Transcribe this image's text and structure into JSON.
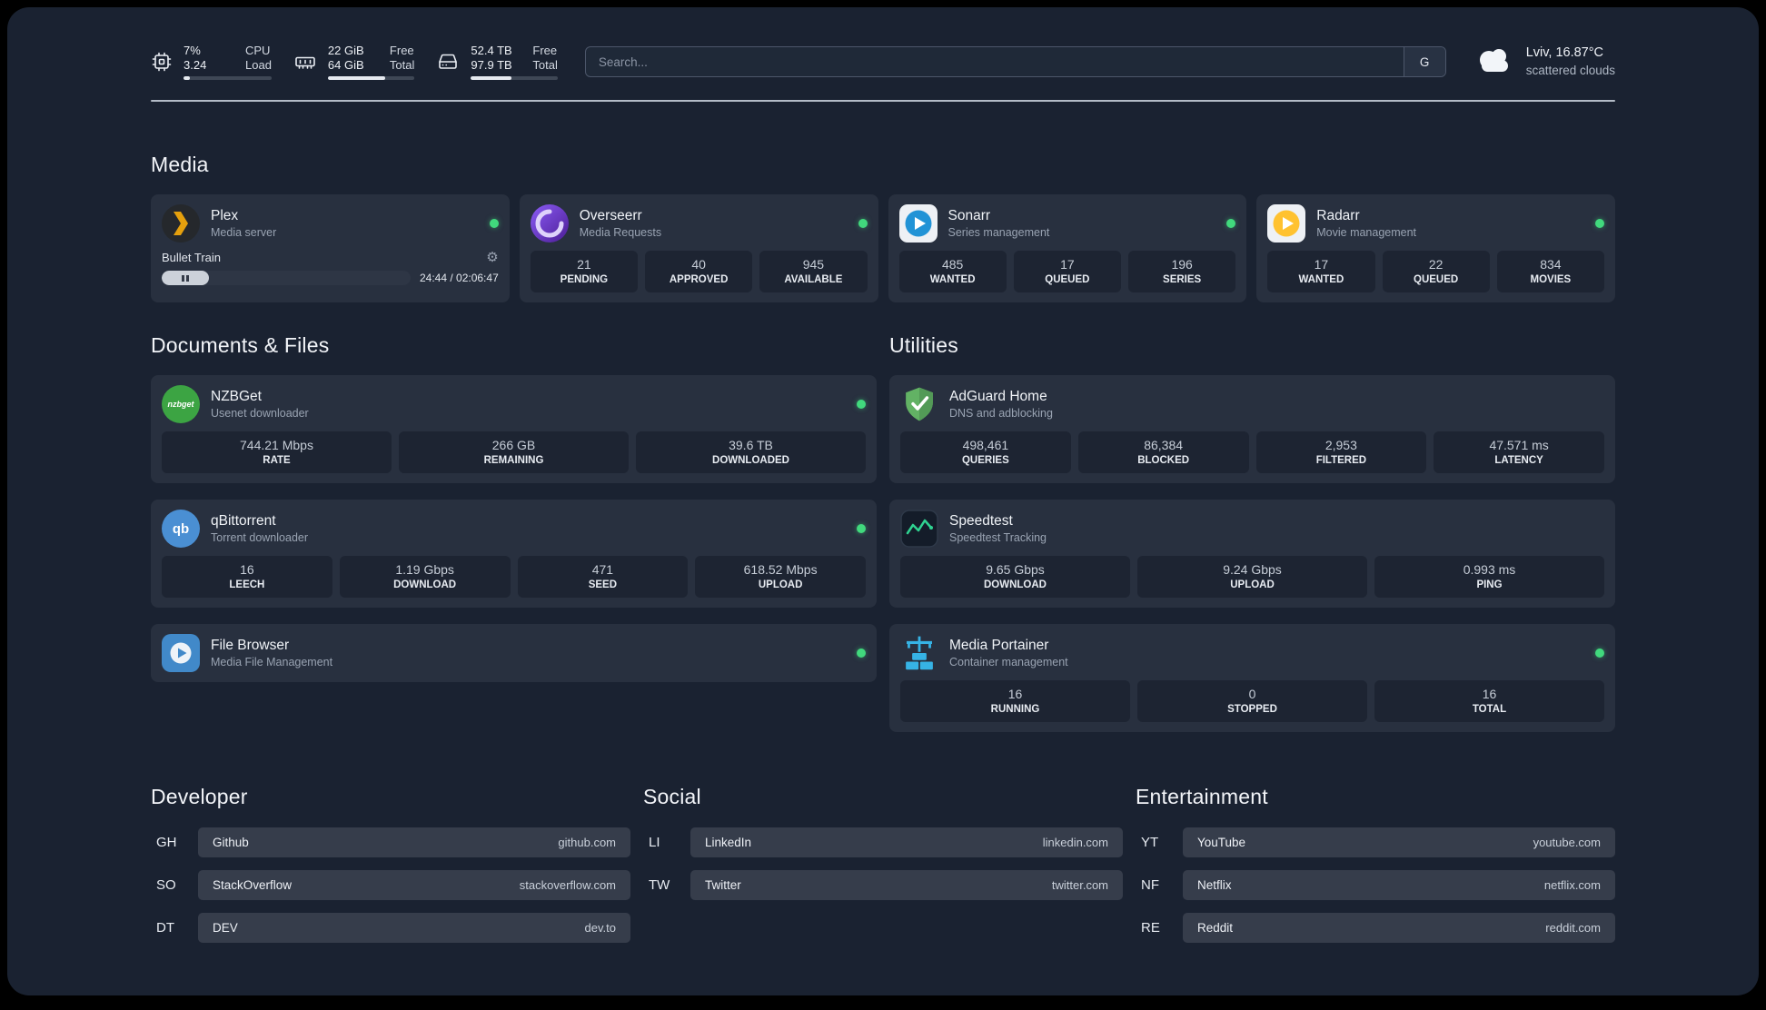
{
  "theme": {
    "page_bg": "#1a2231",
    "card_bg": "#28303f",
    "tile_bg": "#1d2432",
    "pill_bg": "#363d4b",
    "status_green": "#41d97d"
  },
  "icons": {
    "settings": "⚙"
  },
  "header": {
    "cpu": {
      "value_top": "7%",
      "value_bottom": "3.24",
      "label_top": "CPU",
      "label_bottom": "Load"
    },
    "memory": {
      "value_top": "22 GiB",
      "value_bottom": "64 GiB",
      "label_top": "Free",
      "label_bottom": "Total"
    },
    "disk": {
      "value_top": "52.4 TB",
      "value_bottom": "97.9 TB",
      "label_top": "Free",
      "label_bottom": "Total"
    },
    "search": {
      "placeholder": "Search...",
      "provider_label": "G"
    },
    "weather": {
      "location": "Lviv, 16.87°C",
      "condition": "scattered clouds"
    }
  },
  "meters": {
    "cpu_pct": 7,
    "memory_used_pct": 66,
    "disk_used_pct": 47,
    "plex_progress_pct": 19
  },
  "sections": {
    "media": "Media",
    "documents": "Documents & Files",
    "utilities": "Utilities"
  },
  "services": {
    "plex": {
      "name": "Plex",
      "subtitle": "Media server",
      "now_playing": "Bullet Train",
      "time": "24:44 / 02:06:47"
    },
    "overseerr": {
      "name": "Overseerr",
      "subtitle": "Media Requests",
      "stats": [
        {
          "value": "21",
          "label": "PENDING"
        },
        {
          "value": "40",
          "label": "APPROVED"
        },
        {
          "value": "945",
          "label": "AVAILABLE"
        }
      ]
    },
    "sonarr": {
      "name": "Sonarr",
      "subtitle": "Series management",
      "stats": [
        {
          "value": "485",
          "label": "WANTED"
        },
        {
          "value": "17",
          "label": "QUEUED"
        },
        {
          "value": "196",
          "label": "SERIES"
        }
      ]
    },
    "radarr": {
      "name": "Radarr",
      "subtitle": "Movie management",
      "stats": [
        {
          "value": "17",
          "label": "WANTED"
        },
        {
          "value": "22",
          "label": "QUEUED"
        },
        {
          "value": "834",
          "label": "MOVIES"
        }
      ]
    },
    "nzbget": {
      "name": "NZBGet",
      "subtitle": "Usenet downloader",
      "icon_text": "nzbget",
      "stats": [
        {
          "value": "744.21 Mbps",
          "label": "RATE"
        },
        {
          "value": "266 GB",
          "label": "REMAINING"
        },
        {
          "value": "39.6 TB",
          "label": "DOWNLOADED"
        }
      ]
    },
    "qbittorrent": {
      "name": "qBittorrent",
      "subtitle": "Torrent downloader",
      "icon_text": "qb",
      "stats": [
        {
          "value": "16",
          "label": "LEECH"
        },
        {
          "value": "1.19 Gbps",
          "label": "DOWNLOAD"
        },
        {
          "value": "471",
          "label": "SEED"
        },
        {
          "value": "618.52 Mbps",
          "label": "UPLOAD"
        }
      ]
    },
    "filebrowser": {
      "name": "File Browser",
      "subtitle": "Media File Management"
    },
    "adguard": {
      "name": "AdGuard Home",
      "subtitle": "DNS and adblocking",
      "stats": [
        {
          "value": "498,461",
          "label": "QUERIES"
        },
        {
          "value": "86,384",
          "label": "BLOCKED"
        },
        {
          "value": "2,953",
          "label": "FILTERED"
        },
        {
          "value": "47.571 ms",
          "label": "LATENCY"
        }
      ]
    },
    "speedtest": {
      "name": "Speedtest",
      "subtitle": "Speedtest Tracking",
      "stats": [
        {
          "value": "9.65 Gbps",
          "label": "DOWNLOAD"
        },
        {
          "value": "9.24 Gbps",
          "label": "UPLOAD"
        },
        {
          "value": "0.993 ms",
          "label": "PING"
        }
      ]
    },
    "portainer": {
      "name": "Media Portainer",
      "subtitle": "Container management",
      "stats": [
        {
          "value": "16",
          "label": "RUNNING"
        },
        {
          "value": "0",
          "label": "STOPPED"
        },
        {
          "value": "16",
          "label": "TOTAL"
        }
      ]
    }
  },
  "bookmarks": {
    "developer": {
      "title": "Developer",
      "items": [
        {
          "abbr": "GH",
          "name": "Github",
          "url": "github.com"
        },
        {
          "abbr": "SO",
          "name": "StackOverflow",
          "url": "stackoverflow.com"
        },
        {
          "abbr": "DT",
          "name": "DEV",
          "url": "dev.to"
        }
      ]
    },
    "social": {
      "title": "Social",
      "items": [
        {
          "abbr": "LI",
          "name": "LinkedIn",
          "url": "linkedin.com"
        },
        {
          "abbr": "TW",
          "name": "Twitter",
          "url": "twitter.com"
        }
      ]
    },
    "entertainment": {
      "title": "Entertainment",
      "items": [
        {
          "abbr": "YT",
          "name": "YouTube",
          "url": "youtube.com"
        },
        {
          "abbr": "NF",
          "name": "Netflix",
          "url": "netflix.com"
        },
        {
          "abbr": "RE",
          "name": "Reddit",
          "url": "reddit.com"
        }
      ]
    }
  }
}
